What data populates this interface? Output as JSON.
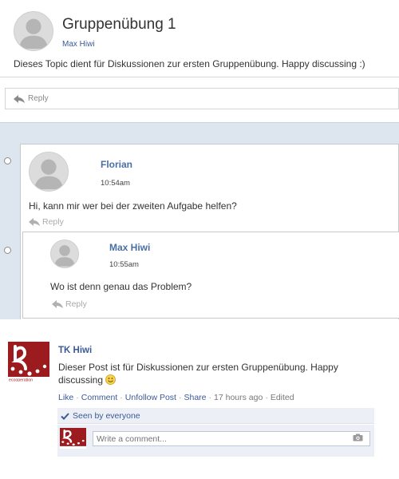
{
  "topic": {
    "title": "Gruppenübung 1",
    "author": "Max Hiwi",
    "body": "Dieses Topic dient für Diskussionen zur ersten Gruppenübung. Happy discussing :)",
    "reply_label": "Reply"
  },
  "thread": {
    "comments": [
      {
        "author": "Florian",
        "time": "10:54am",
        "text": "Hi, kann mir wer bei der zweiten Aufgabe helfen?",
        "reply_label": "Reply"
      },
      {
        "author": "Max Hiwi",
        "time": "10:55am",
        "text": "Wo ist denn genau das Problem?",
        "reply_label": "Reply"
      }
    ]
  },
  "fb_post": {
    "author": "TK Hiwi",
    "text": "Dieser Post ist für Diskussionen zur ersten Gruppenübung. Happy discussing",
    "logo_text": "ecooperation",
    "actions": {
      "like": "Like",
      "comment": "Comment",
      "unfollow": "Unfollow Post",
      "share": "Share",
      "time": "17 hours ago",
      "edited": "Edited"
    },
    "seen_label": "Seen by everyone",
    "comment_placeholder": "Write a comment..."
  },
  "colors": {
    "link": "#3b5998",
    "author_blue": "#4a6fa5",
    "thread_bg": "#dde6ef",
    "logo_red": "#9b1b1f"
  }
}
